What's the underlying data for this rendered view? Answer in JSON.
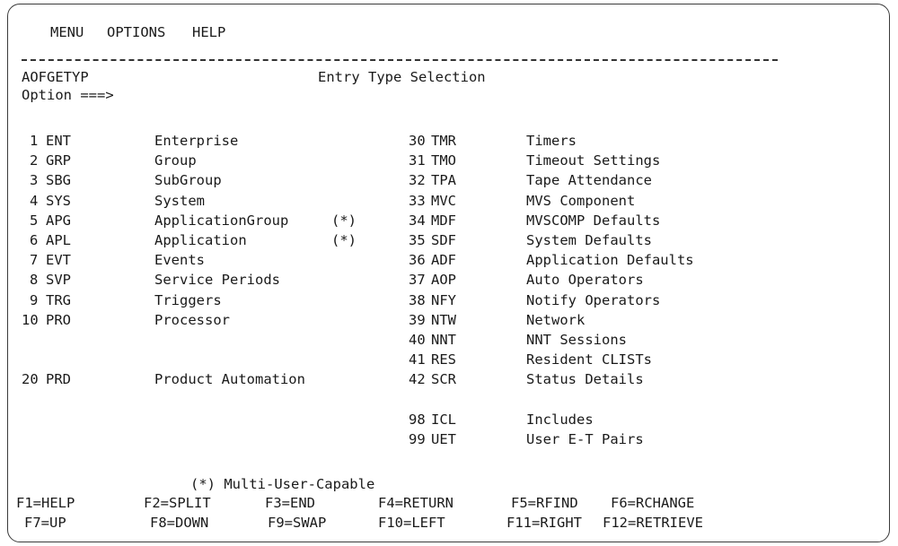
{
  "menubar": {
    "items": [
      "MENU",
      "OPTIONS",
      "HELP"
    ]
  },
  "panel": {
    "id": "AOFGETYP",
    "title": "Entry Type Selection"
  },
  "option_prompt": "Option ===>",
  "option_value": "",
  "left_entries": [
    {
      "num": "1",
      "code": "ENT",
      "desc": "Enterprise",
      "flag": ""
    },
    {
      "num": "2",
      "code": "GRP",
      "desc": "Group",
      "flag": ""
    },
    {
      "num": "3",
      "code": "SBG",
      "desc": "SubGroup",
      "flag": ""
    },
    {
      "num": "4",
      "code": "SYS",
      "desc": "System",
      "flag": ""
    },
    {
      "num": "5",
      "code": "APG",
      "desc": "ApplicationGroup",
      "flag": "(*)"
    },
    {
      "num": "6",
      "code": "APL",
      "desc": "Application",
      "flag": "(*)"
    },
    {
      "num": "7",
      "code": "EVT",
      "desc": "Events",
      "flag": ""
    },
    {
      "num": "8",
      "code": "SVP",
      "desc": "Service Periods",
      "flag": ""
    },
    {
      "num": "9",
      "code": "TRG",
      "desc": "Triggers",
      "flag": ""
    },
    {
      "num": "10",
      "code": "PRO",
      "desc": "Processor",
      "flag": ""
    },
    {
      "num": "20",
      "code": "PRD",
      "desc": "Product Automation",
      "flag": ""
    }
  ],
  "right_entries": [
    {
      "num": "30",
      "code": "TMR",
      "desc": "Timers"
    },
    {
      "num": "31",
      "code": "TMO",
      "desc": "Timeout Settings"
    },
    {
      "num": "32",
      "code": "TPA",
      "desc": "Tape Attendance"
    },
    {
      "num": "33",
      "code": "MVC",
      "desc": "MVS Component"
    },
    {
      "num": "34",
      "code": "MDF",
      "desc": "MVSCOMP Defaults"
    },
    {
      "num": "35",
      "code": "SDF",
      "desc": "System Defaults"
    },
    {
      "num": "36",
      "code": "ADF",
      "desc": "Application Defaults"
    },
    {
      "num": "37",
      "code": "AOP",
      "desc": "Auto Operators"
    },
    {
      "num": "38",
      "code": "NFY",
      "desc": "Notify Operators"
    },
    {
      "num": "39",
      "code": "NTW",
      "desc": "Network"
    },
    {
      "num": "40",
      "code": "NNT",
      "desc": "NNT Sessions"
    },
    {
      "num": "41",
      "code": "RES",
      "desc": "Resident CLISTs"
    },
    {
      "num": "42",
      "code": "SCR",
      "desc": "Status Details"
    },
    {
      "num": "98",
      "code": "ICL",
      "desc": "Includes"
    },
    {
      "num": "99",
      "code": "UET",
      "desc": "User E-T Pairs"
    }
  ],
  "footnote": "(*) Multi-User-Capable",
  "function_keys": [
    [
      "F1=HELP",
      "F2=SPLIT",
      "F3=END",
      "F4=RETURN",
      "F5=RFIND",
      "F6=RCHANGE"
    ],
    [
      "F7=UP",
      "F8=DOWN",
      "F9=SWAP",
      "F10=LEFT",
      "F11=RIGHT",
      "F12=RETRIEVE"
    ]
  ]
}
